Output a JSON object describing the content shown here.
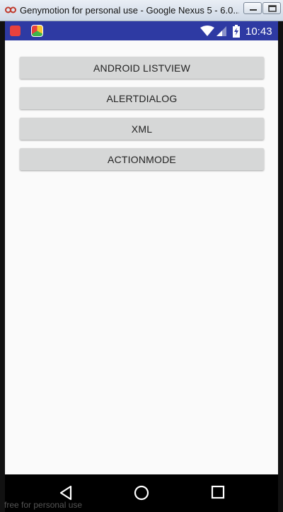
{
  "window": {
    "title": "Genymotion for personal use - Google Nexus 5 - 6.0...",
    "minimize_icon": "minimize-icon",
    "maximize_icon": "maximize-icon"
  },
  "statusbar": {
    "time": "10:43",
    "icons": [
      "app-notification-icon",
      "app-notification-icon-2",
      "wifi-icon",
      "signal-icon",
      "battery-icon"
    ],
    "color": "#2e3aa3"
  },
  "buttons": [
    {
      "label": "ANDROID LISTVIEW"
    },
    {
      "label": "ALERTDIALOG"
    },
    {
      "label": "XML"
    },
    {
      "label": "ACTIONMODE"
    }
  ],
  "navbar": {
    "icons": [
      "back-icon",
      "home-icon",
      "recent-apps-icon"
    ]
  },
  "watermark": "free for personal use"
}
